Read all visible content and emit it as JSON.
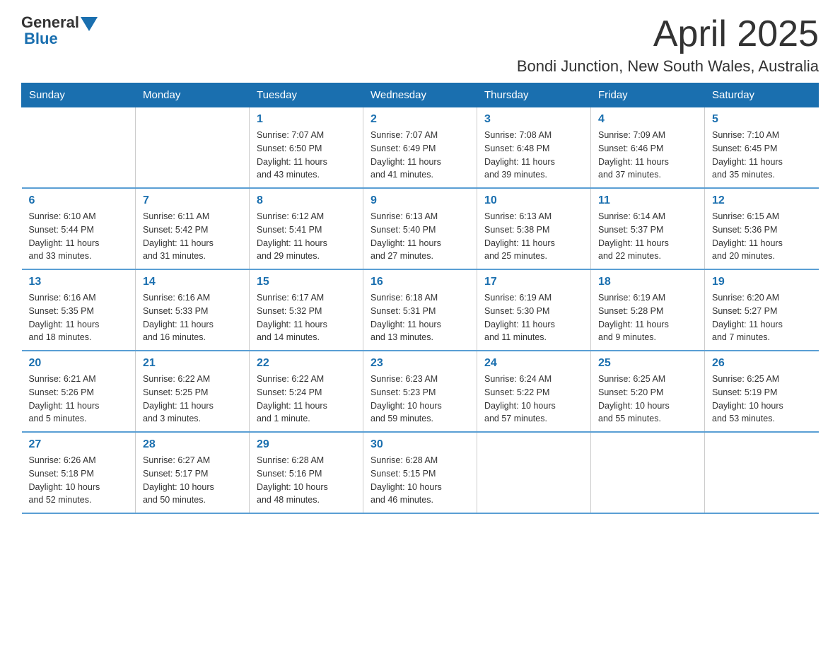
{
  "logo": {
    "text_general": "General",
    "text_blue": "Blue"
  },
  "header": {
    "month_title": "April 2025",
    "location": "Bondi Junction, New South Wales, Australia"
  },
  "weekdays": [
    "Sunday",
    "Monday",
    "Tuesday",
    "Wednesday",
    "Thursday",
    "Friday",
    "Saturday"
  ],
  "weeks": [
    [
      {
        "day": "",
        "info": ""
      },
      {
        "day": "",
        "info": ""
      },
      {
        "day": "1",
        "info": "Sunrise: 7:07 AM\nSunset: 6:50 PM\nDaylight: 11 hours\nand 43 minutes."
      },
      {
        "day": "2",
        "info": "Sunrise: 7:07 AM\nSunset: 6:49 PM\nDaylight: 11 hours\nand 41 minutes."
      },
      {
        "day": "3",
        "info": "Sunrise: 7:08 AM\nSunset: 6:48 PM\nDaylight: 11 hours\nand 39 minutes."
      },
      {
        "day": "4",
        "info": "Sunrise: 7:09 AM\nSunset: 6:46 PM\nDaylight: 11 hours\nand 37 minutes."
      },
      {
        "day": "5",
        "info": "Sunrise: 7:10 AM\nSunset: 6:45 PM\nDaylight: 11 hours\nand 35 minutes."
      }
    ],
    [
      {
        "day": "6",
        "info": "Sunrise: 6:10 AM\nSunset: 5:44 PM\nDaylight: 11 hours\nand 33 minutes."
      },
      {
        "day": "7",
        "info": "Sunrise: 6:11 AM\nSunset: 5:42 PM\nDaylight: 11 hours\nand 31 minutes."
      },
      {
        "day": "8",
        "info": "Sunrise: 6:12 AM\nSunset: 5:41 PM\nDaylight: 11 hours\nand 29 minutes."
      },
      {
        "day": "9",
        "info": "Sunrise: 6:13 AM\nSunset: 5:40 PM\nDaylight: 11 hours\nand 27 minutes."
      },
      {
        "day": "10",
        "info": "Sunrise: 6:13 AM\nSunset: 5:38 PM\nDaylight: 11 hours\nand 25 minutes."
      },
      {
        "day": "11",
        "info": "Sunrise: 6:14 AM\nSunset: 5:37 PM\nDaylight: 11 hours\nand 22 minutes."
      },
      {
        "day": "12",
        "info": "Sunrise: 6:15 AM\nSunset: 5:36 PM\nDaylight: 11 hours\nand 20 minutes."
      }
    ],
    [
      {
        "day": "13",
        "info": "Sunrise: 6:16 AM\nSunset: 5:35 PM\nDaylight: 11 hours\nand 18 minutes."
      },
      {
        "day": "14",
        "info": "Sunrise: 6:16 AM\nSunset: 5:33 PM\nDaylight: 11 hours\nand 16 minutes."
      },
      {
        "day": "15",
        "info": "Sunrise: 6:17 AM\nSunset: 5:32 PM\nDaylight: 11 hours\nand 14 minutes."
      },
      {
        "day": "16",
        "info": "Sunrise: 6:18 AM\nSunset: 5:31 PM\nDaylight: 11 hours\nand 13 minutes."
      },
      {
        "day": "17",
        "info": "Sunrise: 6:19 AM\nSunset: 5:30 PM\nDaylight: 11 hours\nand 11 minutes."
      },
      {
        "day": "18",
        "info": "Sunrise: 6:19 AM\nSunset: 5:28 PM\nDaylight: 11 hours\nand 9 minutes."
      },
      {
        "day": "19",
        "info": "Sunrise: 6:20 AM\nSunset: 5:27 PM\nDaylight: 11 hours\nand 7 minutes."
      }
    ],
    [
      {
        "day": "20",
        "info": "Sunrise: 6:21 AM\nSunset: 5:26 PM\nDaylight: 11 hours\nand 5 minutes."
      },
      {
        "day": "21",
        "info": "Sunrise: 6:22 AM\nSunset: 5:25 PM\nDaylight: 11 hours\nand 3 minutes."
      },
      {
        "day": "22",
        "info": "Sunrise: 6:22 AM\nSunset: 5:24 PM\nDaylight: 11 hours\nand 1 minute."
      },
      {
        "day": "23",
        "info": "Sunrise: 6:23 AM\nSunset: 5:23 PM\nDaylight: 10 hours\nand 59 minutes."
      },
      {
        "day": "24",
        "info": "Sunrise: 6:24 AM\nSunset: 5:22 PM\nDaylight: 10 hours\nand 57 minutes."
      },
      {
        "day": "25",
        "info": "Sunrise: 6:25 AM\nSunset: 5:20 PM\nDaylight: 10 hours\nand 55 minutes."
      },
      {
        "day": "26",
        "info": "Sunrise: 6:25 AM\nSunset: 5:19 PM\nDaylight: 10 hours\nand 53 minutes."
      }
    ],
    [
      {
        "day": "27",
        "info": "Sunrise: 6:26 AM\nSunset: 5:18 PM\nDaylight: 10 hours\nand 52 minutes."
      },
      {
        "day": "28",
        "info": "Sunrise: 6:27 AM\nSunset: 5:17 PM\nDaylight: 10 hours\nand 50 minutes."
      },
      {
        "day": "29",
        "info": "Sunrise: 6:28 AM\nSunset: 5:16 PM\nDaylight: 10 hours\nand 48 minutes."
      },
      {
        "day": "30",
        "info": "Sunrise: 6:28 AM\nSunset: 5:15 PM\nDaylight: 10 hours\nand 46 minutes."
      },
      {
        "day": "",
        "info": ""
      },
      {
        "day": "",
        "info": ""
      },
      {
        "day": "",
        "info": ""
      }
    ]
  ]
}
